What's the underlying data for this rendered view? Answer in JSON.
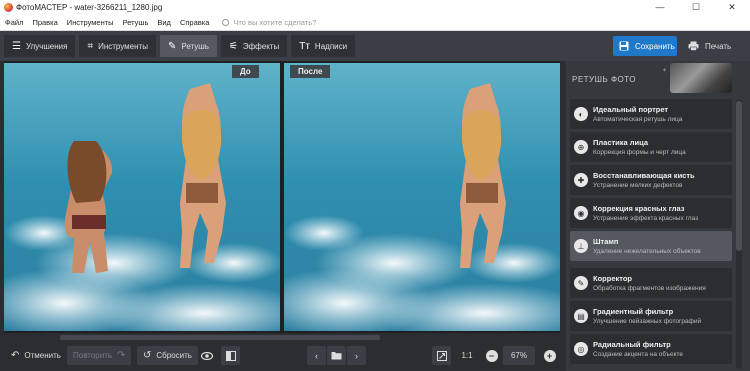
{
  "window": {
    "title": "ФотоМАСТЕР - water-3266211_1280.jpg",
    "minimize": "—",
    "maximize": "☐",
    "close": "✕"
  },
  "menu": {
    "items": [
      "Файл",
      "Правка",
      "Инструменты",
      "Ретушь",
      "Вид",
      "Справка"
    ],
    "search_placeholder": "Что вы хотите сделать?"
  },
  "toolbar": {
    "tabs": [
      {
        "label": "Улучшения",
        "icon": "sliders-icon",
        "glyph": "☰"
      },
      {
        "label": "Инструменты",
        "icon": "crop-icon",
        "glyph": "⌗"
      },
      {
        "label": "Ретушь",
        "icon": "brush-icon",
        "glyph": "✎"
      },
      {
        "label": "Эффекты",
        "icon": "magic-wand-icon",
        "glyph": "⚟"
      },
      {
        "label": "Надписи",
        "icon": "text-icon",
        "glyph": "Tт"
      }
    ],
    "active_tab": "Ретушь",
    "save_label": "Сохранить",
    "print_label": "Печать"
  },
  "canvas": {
    "before_label": "До",
    "after_label": "После"
  },
  "panel": {
    "title": "РЕТУШЬ ФОТО",
    "items": [
      {
        "title": "Идеальный портрет",
        "desc": "Автоматическая ретушь лица",
        "icon": "portrait-icon",
        "glyph": "◐"
      },
      {
        "title": "Пластика лица",
        "desc": "Коррекция формы и черт лица",
        "icon": "face-icon",
        "glyph": "⊕"
      },
      {
        "title": "Восстанавливающая кисть",
        "desc": "Устранение мелких дефектов",
        "icon": "bandage-icon",
        "glyph": "✚"
      },
      {
        "title": "Коррекция красных глаз",
        "desc": "Устранение эффекта красных глаз",
        "icon": "eye-icon",
        "glyph": "◉"
      },
      {
        "title": "Штамп",
        "desc": "Удаление нежелательных объектов",
        "icon": "stamp-icon",
        "glyph": "⊥"
      },
      {
        "title": "Корректор",
        "desc": "Обработка фрагментов изображения",
        "icon": "brush-icon",
        "glyph": "✎"
      },
      {
        "title": "Градиентный фильтр",
        "desc": "Улучшение пейзажных фотографий",
        "icon": "gradient-icon",
        "glyph": "▤"
      },
      {
        "title": "Радиальный фильтр",
        "desc": "Создание акцента на объекте",
        "icon": "radial-icon",
        "glyph": "◎"
      }
    ],
    "selected_item": "Штамп"
  },
  "bottom": {
    "undo_label": "Отменить",
    "redo_label": "Повторить",
    "reset_label": "Сбросить",
    "ratio_label": "1:1",
    "zoom_value": "67%"
  },
  "colors": {
    "accent": "#1f78c8",
    "background": "#2b2d31",
    "panel": "#35383d"
  }
}
